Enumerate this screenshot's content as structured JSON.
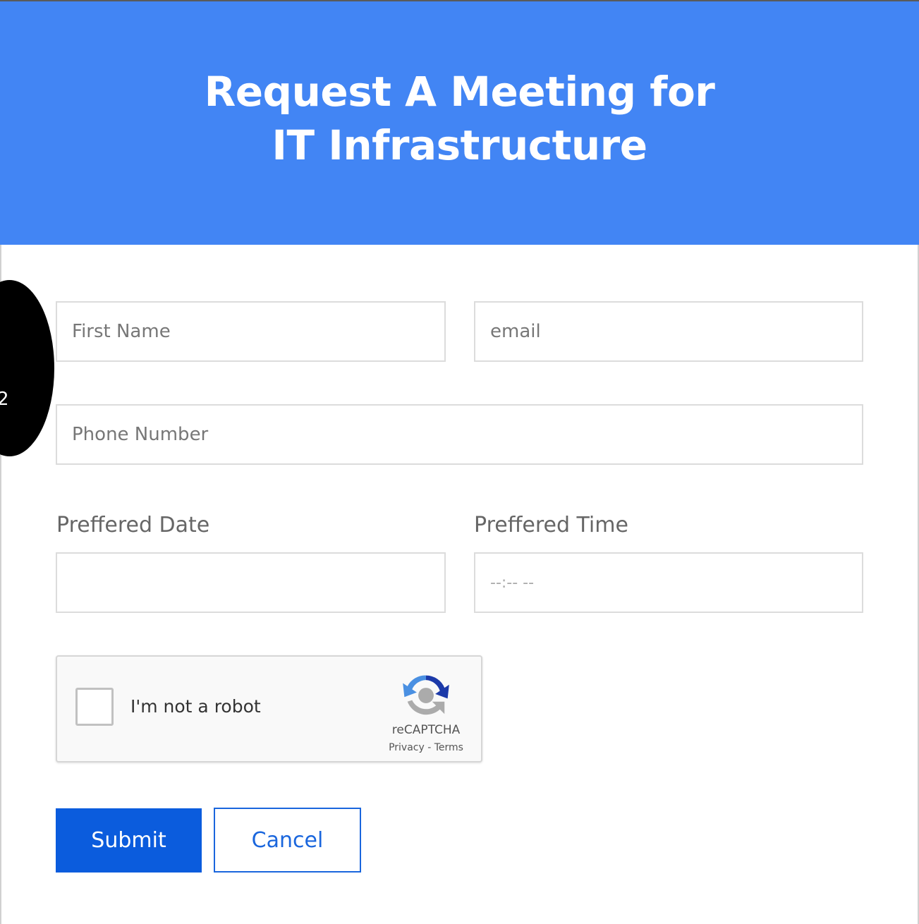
{
  "header": {
    "title_line1": "Request A Meeting for",
    "title_line2": "IT Infrastructure",
    "background_color": "#4285f4"
  },
  "badge": {
    "number": "2"
  },
  "form": {
    "first_name_placeholder": "First Name",
    "email_placeholder": "email",
    "phone_placeholder": "Phone Number",
    "date_label": "Preffered Date",
    "date_value": "",
    "time_label": "Preffered Time",
    "time_placeholder": "--:-- --"
  },
  "captcha": {
    "label": "I'm not a robot",
    "brand": "reCAPTCHA",
    "links": "Privacy - Terms",
    "icon": "recaptcha-logo-icon"
  },
  "buttons": {
    "submit_label": "Submit",
    "cancel_label": "Cancel",
    "submit_color": "#0b5cdd",
    "cancel_color": "#1a66dd"
  }
}
